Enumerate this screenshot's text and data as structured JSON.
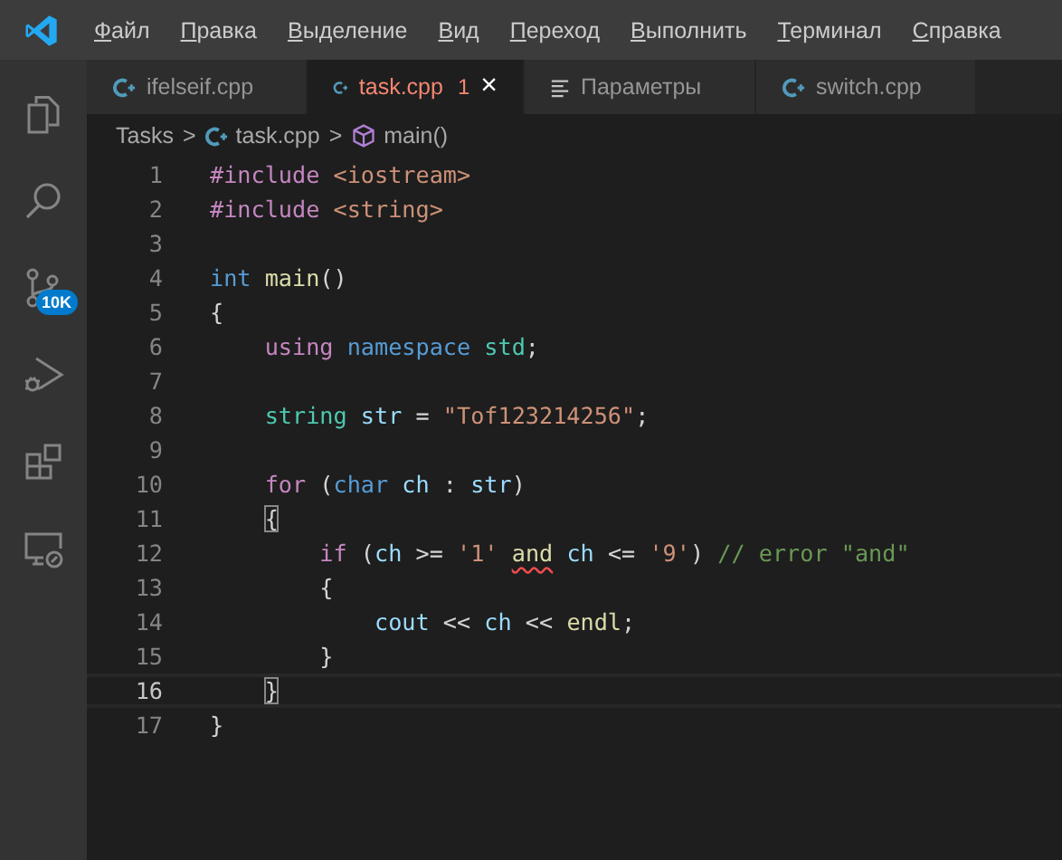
{
  "menu": [
    "Файл",
    "Правка",
    "Выделение",
    "Вид",
    "Переход",
    "Выполнить",
    "Терминал",
    "Справка"
  ],
  "activity_bar": [
    {
      "kind": "files",
      "selected": false
    },
    {
      "kind": "search",
      "selected": false
    },
    {
      "kind": "source-control",
      "selected": false,
      "badge": "10K"
    },
    {
      "kind": "run",
      "selected": false
    },
    {
      "kind": "extensions",
      "selected": false
    },
    {
      "kind": "remote",
      "selected": false
    }
  ],
  "tabs": [
    {
      "label": "ifelseif.cpp",
      "kind": "cpp",
      "selected": false
    },
    {
      "label": "task.cpp",
      "kind": "cpp",
      "selected": true,
      "problems": "1",
      "close": "×"
    },
    {
      "label": "Параметры",
      "kind": "settings",
      "selected": false
    },
    {
      "label": "switch.cpp",
      "kind": "cpp",
      "selected": false
    }
  ],
  "breadcrumbs": [
    {
      "label": "Tasks",
      "kind": "folder"
    },
    {
      "label": ">",
      "kind": "separator"
    },
    {
      "label": "task.cpp",
      "kind": "cpp"
    },
    {
      "label": ">",
      "kind": "separator"
    },
    {
      "label": "main()",
      "kind": "function"
    }
  ],
  "code": [
    {
      "number": "1",
      "current": false,
      "tokens": [
        {
          "text": "#include",
          "kind": "control"
        },
        {
          "text": " <iostream>",
          "kind": "string"
        }
      ]
    },
    {
      "number": "2",
      "current": false,
      "tokens": [
        {
          "text": "#include",
          "kind": "control"
        },
        {
          "text": " <string>",
          "kind": "string"
        }
      ]
    },
    {
      "number": "3",
      "current": false
    },
    {
      "number": "4",
      "current": false,
      "tokens": [
        {
          "text": "int",
          "kind": "keyword"
        },
        {
          "text": " main",
          "kind": "function"
        },
        {
          "text": "()",
          "kind": "plain"
        }
      ]
    },
    {
      "number": "5",
      "current": false,
      "tokens": [
        {
          "text": "{",
          "kind": "plain"
        }
      ]
    },
    {
      "number": "6",
      "current": false,
      "tokens": [
        {
          "text": "    using",
          "kind": "control"
        },
        {
          "text": " namespace",
          "kind": "keyword"
        },
        {
          "text": " std",
          "kind": "type"
        },
        {
          "text": ";",
          "kind": "plain"
        }
      ]
    },
    {
      "number": "7",
      "current": false
    },
    {
      "number": "8",
      "current": false,
      "tokens": [
        {
          "text": "    string",
          "kind": "type"
        },
        {
          "text": " str",
          "kind": "variable"
        },
        {
          "text": " = ",
          "kind": "plain"
        },
        {
          "text": "\"Tof123214256\"",
          "kind": "string"
        },
        {
          "text": ";",
          "kind": "plain"
        }
      ]
    },
    {
      "number": "9",
      "current": false
    },
    {
      "number": "10",
      "current": false,
      "tokens": [
        {
          "text": "    for",
          "kind": "control"
        },
        {
          "text": " (",
          "kind": "plain"
        },
        {
          "text": "char",
          "kind": "keyword"
        },
        {
          "text": " ch",
          "kind": "variable"
        },
        {
          "text": " : ",
          "kind": "plain"
        },
        {
          "text": "str",
          "kind": "variable"
        },
        {
          "text": ")",
          "kind": "plain"
        }
      ]
    },
    {
      "number": "11",
      "current": false,
      "tokens": [
        {
          "text": "    {",
          "kind": "bracket-match"
        }
      ]
    },
    {
      "number": "12",
      "current": false,
      "tokens": [
        {
          "text": "        if",
          "kind": "control"
        },
        {
          "text": " (",
          "kind": "plain"
        },
        {
          "text": "ch",
          "kind": "variable"
        },
        {
          "text": " >= ",
          "kind": "plain"
        },
        {
          "text": "'1' ",
          "kind": "string"
        },
        {
          "text": "and",
          "kind": "error"
        },
        {
          "text": " ch",
          "kind": "variable"
        },
        {
          "text": " <= ",
          "kind": "plain"
        },
        {
          "text": "'9'",
          "kind": "string"
        },
        {
          "text": ") ",
          "kind": "plain"
        },
        {
          "text": "// error \"and\"",
          "kind": "comment"
        }
      ]
    },
    {
      "number": "13",
      "current": false,
      "tokens": [
        {
          "text": "        {",
          "kind": "plain"
        }
      ]
    },
    {
      "number": "14",
      "current": false,
      "tokens": [
        {
          "text": "            cout",
          "kind": "variable"
        },
        {
          "text": " << ",
          "kind": "plain"
        },
        {
          "text": "ch",
          "kind": "variable"
        },
        {
          "text": " << ",
          "kind": "plain"
        },
        {
          "text": "endl",
          "kind": "function"
        },
        {
          "text": ";",
          "kind": "plain"
        }
      ]
    },
    {
      "number": "15",
      "current": false,
      "tokens": [
        {
          "text": "        }",
          "kind": "plain"
        }
      ]
    },
    {
      "number": "16",
      "current": true,
      "tokens": [
        {
          "text": "    }",
          "kind": "bracket-match"
        }
      ]
    },
    {
      "number": "17",
      "current": false,
      "tokens": [
        {
          "text": "}",
          "kind": "plain"
        }
      ]
    }
  ]
}
